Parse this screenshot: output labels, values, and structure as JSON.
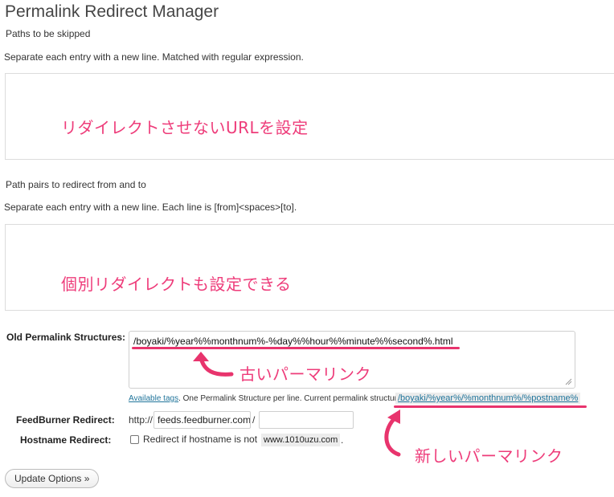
{
  "page_title": "Permalink Redirect Manager",
  "skip_section": {
    "label": "Paths to be skipped",
    "description": "Separate each entry with a new line. Matched with regular expression.",
    "annotation": "リダイレクトさせないURLを設定"
  },
  "pairs_section": {
    "label": "Path pairs to redirect from and to",
    "description": "Separate each entry with a new line. Each line is [from]<spaces>[to].",
    "annotation": "個別リダイレクトも設定できる"
  },
  "old_permalink": {
    "label": "Old Permalink Structures:",
    "value": "/boyaki/%year%%monthnum%-%day%%hour%%minute%%second%.html",
    "annotation": "古いパーマリンク",
    "note_link": "Available tags",
    "note_text": ". One Permalink Structure per line. Current permalink structure:",
    "current_structure": "/boyaki/%year%/%monthnum%/%postname%",
    "current_annotation": "新しいパーマリンク"
  },
  "feedburner": {
    "label": "FeedBurner Redirect:",
    "prefix": "http://",
    "host_value": "feeds.feedburner.com",
    "separator": "/",
    "path_value": ""
  },
  "hostname": {
    "label": "Hostname Redirect:",
    "checkbox_label": "Redirect if hostname is not",
    "hostname_value": "www.1010uzu.com",
    "suffix": "."
  },
  "update_button": "Update Options »",
  "colors": {
    "annotation": "#ee3c7a",
    "link": "#21759b"
  }
}
